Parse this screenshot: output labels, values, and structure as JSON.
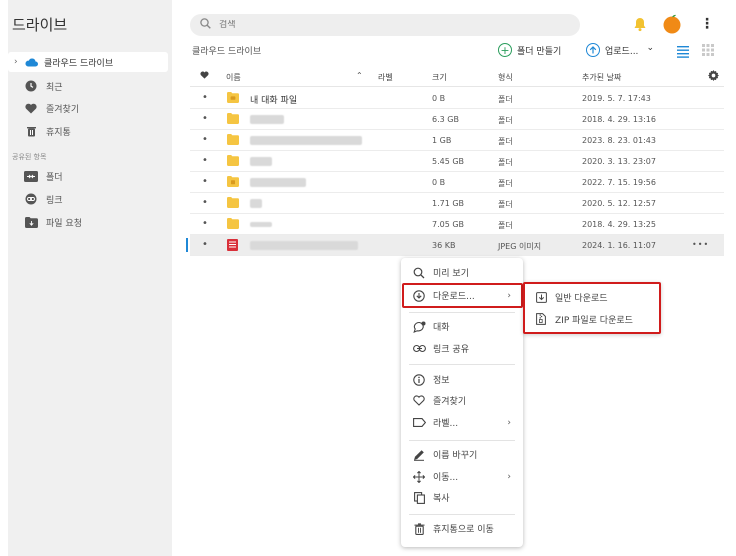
{
  "sidebar": {
    "title": "드라이브",
    "items": [
      {
        "label": "클라우드 드라이브",
        "chevron": "›"
      },
      {
        "label": "최근"
      },
      {
        "label": "즐겨찾기"
      },
      {
        "label": "휴지통"
      }
    ],
    "shared_section": "공유된 항목",
    "shared_items": [
      {
        "label": "폴더"
      },
      {
        "label": "링크"
      },
      {
        "label": "파일 요청"
      }
    ]
  },
  "header": {
    "search_placeholder": "검색",
    "kebab": "⋮"
  },
  "toolbar": {
    "breadcrumb": "클라우드 드라이브",
    "new_folder": "폴더 만들기",
    "upload": "업로드...",
    "upload_caret": "⌄"
  },
  "table": {
    "headers": {
      "name": "이름",
      "sort": "⌃",
      "label": "라벨",
      "size": "크기",
      "type": "형식",
      "added": "추가된 날짜"
    },
    "rows": [
      {
        "name": "내 대화 파일",
        "size": "0 B",
        "type": "폴더",
        "date": "2019. 5. 7. 17:43"
      },
      {
        "name": "",
        "size": "6.3 GB",
        "type": "폴더",
        "date": "2018. 4. 29. 13:16"
      },
      {
        "name": "",
        "size": "1 GB",
        "type": "폴더",
        "date": "2023. 8. 23. 01:43"
      },
      {
        "name": "",
        "size": "5.45 GB",
        "type": "폴더",
        "date": "2020. 3. 13. 23:07"
      },
      {
        "name": "",
        "size": "0 B",
        "type": "폴더",
        "date": "2022. 7. 15. 19:56"
      },
      {
        "name": "",
        "size": "1.71 GB",
        "type": "폴더",
        "date": "2020. 5. 12. 12:57"
      },
      {
        "name": "",
        "size": "7.05 GB",
        "type": "폴더",
        "date": "2018. 4. 29. 13:25"
      },
      {
        "name": "",
        "size": "36 KB",
        "type": "JPEG 이미지",
        "date": "2024. 1. 16. 11:07",
        "more": "•••"
      }
    ]
  },
  "context_menu": {
    "preview": "미리 보기",
    "download": "다운로드...",
    "chat": "대화",
    "share_link": "링크 공유",
    "info": "정보",
    "favorite": "즐겨찾기",
    "label": "라벨...",
    "rename": "이름 바꾸기",
    "move": "이동...",
    "copy": "복사",
    "trash": "휴지통으로 이동",
    "arrow": "›"
  },
  "download_submenu": {
    "normal": "일반 다운로드",
    "zip": "ZIP 파일로 다운로드"
  },
  "colors": {
    "accent_blue": "#1f88d6",
    "accent_green": "#2a9d5c",
    "highlight_red": "#d01c1c",
    "folder_yellow": "#f5c542",
    "jpeg_red": "#d9303a"
  }
}
